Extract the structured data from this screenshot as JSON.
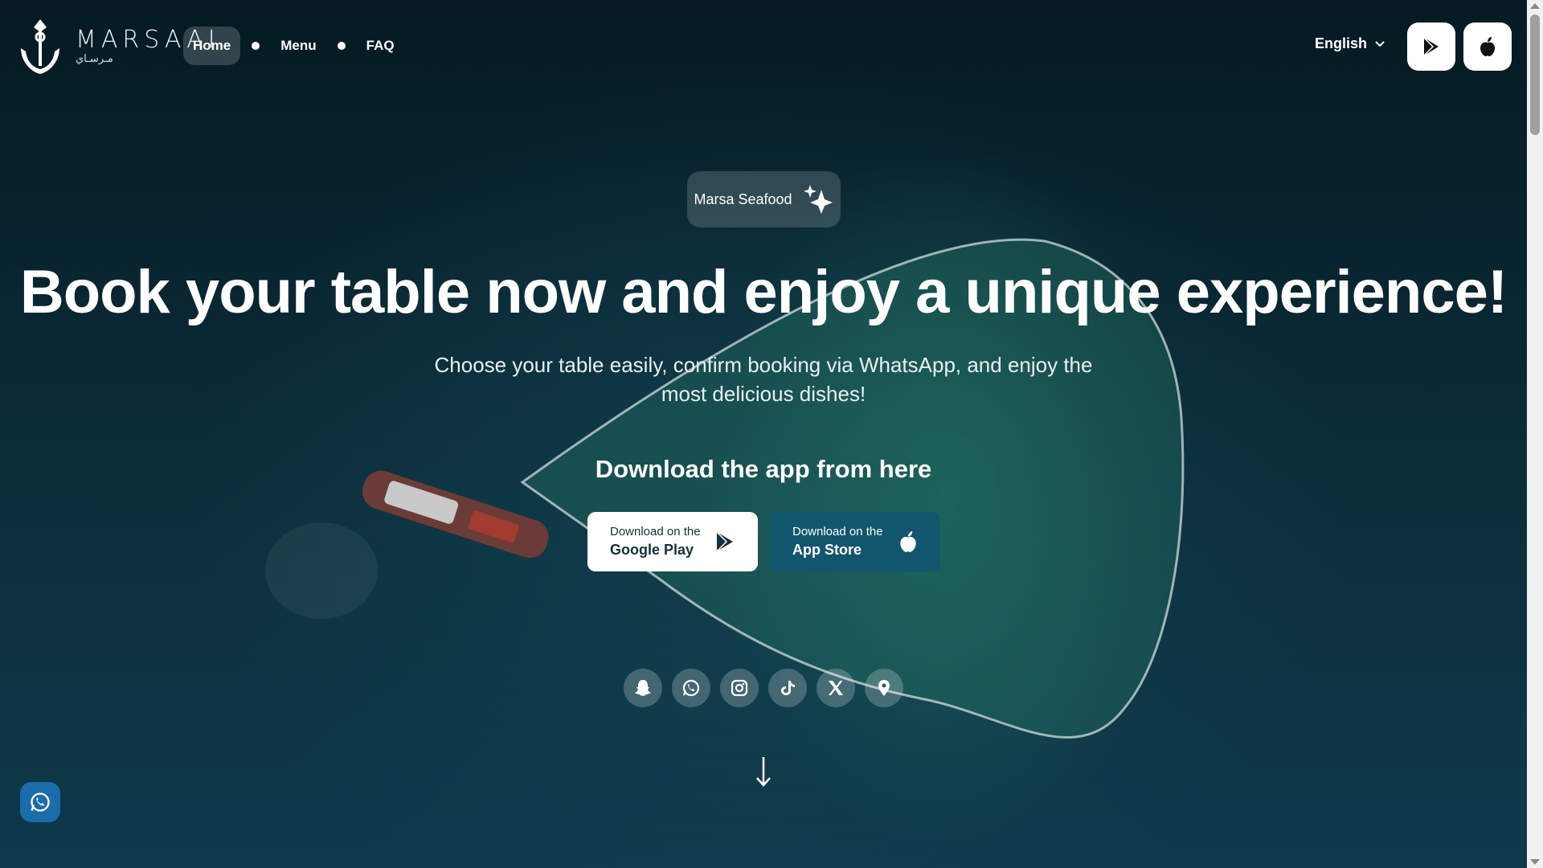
{
  "colors": {
    "active_nav_bg": "#ffffff2e",
    "app_store_button": "#11566c",
    "google_play_button": "#ffffff",
    "whatsapp_float": "#1a6da8"
  },
  "logo": {
    "en": "MARSAAI",
    "ar": "مـرسـاي"
  },
  "nav": [
    {
      "label": "Home",
      "active": true
    },
    {
      "label": "Menu",
      "active": false
    },
    {
      "label": "FAQ",
      "active": false
    }
  ],
  "header": {
    "language": "English",
    "google_play_icon": "play-store-icon",
    "app_store_icon": "apple-icon"
  },
  "hero": {
    "badge": "Marsa Seafood",
    "badge_icon": "sparkles-icon",
    "title": "Book your table now and enjoy a unique experience!",
    "subtitle": "Choose your table easily, confirm booking via WhatsApp, and enjoy the most delicious dishes!",
    "download_title": "Download the app from here"
  },
  "download": {
    "google_play": {
      "small": "Download on the",
      "big": "Google Play"
    },
    "app_store": {
      "small": "Download on the",
      "big": "App Store"
    }
  },
  "socials": [
    "snapchat-icon",
    "whatsapp-icon",
    "instagram-icon",
    "tiktok-icon",
    "x-icon",
    "location-icon"
  ]
}
